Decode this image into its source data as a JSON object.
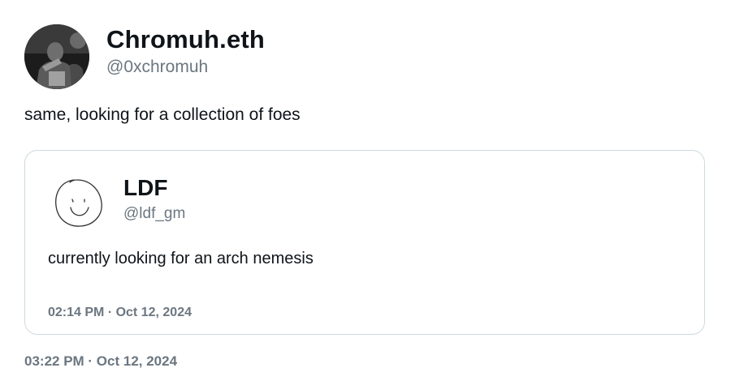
{
  "author": {
    "display_name": "Chromuh.eth",
    "handle": "@0xchromuh",
    "avatar_icon": "profile-photo-icon"
  },
  "tweet": {
    "text": "same, looking for a collection of foes",
    "timestamp": "03:22 PM · Oct 12, 2024"
  },
  "quoted_tweet": {
    "display_name": "LDF",
    "handle": "@ldf_gm",
    "avatar_icon": "smiley-face-doodle-icon",
    "text": "currently looking for an arch nemesis",
    "timestamp": "02:14 PM · Oct 12, 2024"
  },
  "colors": {
    "text_primary": "#0f1419",
    "text_secondary": "#6b7680",
    "border": "#cfd9de"
  }
}
